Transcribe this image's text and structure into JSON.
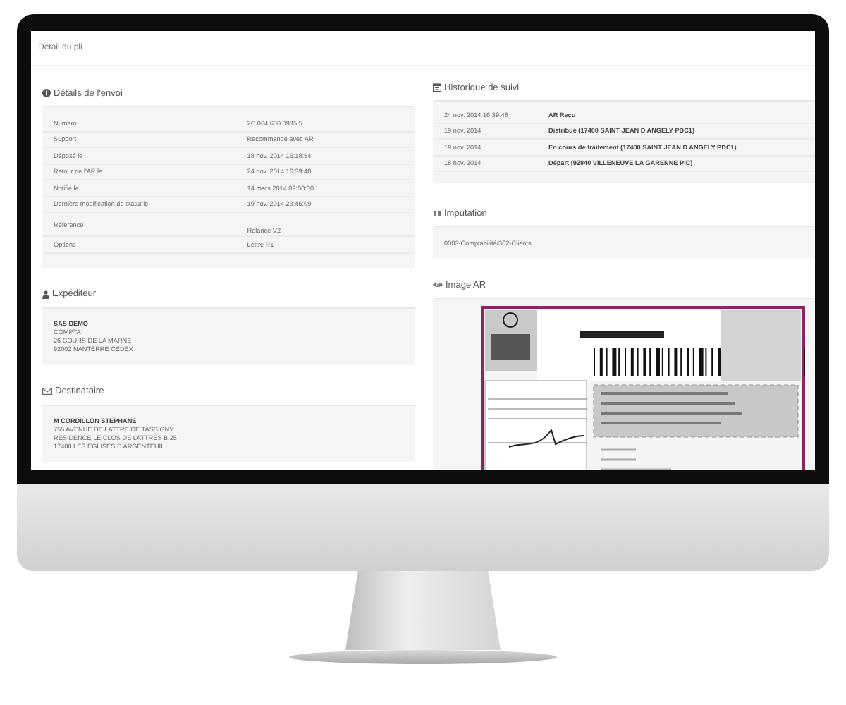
{
  "page": {
    "title": "Détail du pli"
  },
  "details": {
    "heading": "Détails de l'envoi",
    "rows": [
      {
        "label": "Numéro",
        "value": "2C 064 600 0935 5"
      },
      {
        "label": "Support",
        "value": "Recommandé avec AR"
      },
      {
        "label": "Déposé le",
        "value": "18 nov. 2014 16:18:54"
      },
      {
        "label": "Retour de l'AR le",
        "value": "24 nov. 2014 16:39:48"
      },
      {
        "label": "Notifié le",
        "value": "14 mars 2014 09:00:00"
      },
      {
        "label": "Dernière modification de statut le",
        "value": "19 nov. 2014 23:45:09"
      },
      {
        "label": "Référence",
        "value": "Relance V2"
      },
      {
        "label": "Options",
        "value": "Lettre R1"
      }
    ]
  },
  "sender": {
    "heading": "Expéditeur",
    "lines": [
      "SAS DEMO",
      "COMPTA",
      "26 COURS DE LA MARNE",
      "92002 NANTERRE CEDEX"
    ]
  },
  "recipient": {
    "heading": "Destinataire",
    "lines": [
      "M CORDILLON STEPHANE",
      "755 AVENUE DE LATTRE DE TASSIGNY",
      "RESIDENCE LE CLOS DE LATTRES B 25",
      "17400 LES EGLISES D ARGENTEUIL"
    ]
  },
  "history": {
    "heading": "Historique de suivi",
    "rows": [
      {
        "date": "24 nov. 2014 16:39:48",
        "event": "AR Reçu"
      },
      {
        "date": "19 nov. 2014",
        "event": "Distribué (17400 SAINT JEAN D ANGELY PDC1)"
      },
      {
        "date": "19 nov. 2014",
        "event": "En cours de traitement (17400 SAINT JEAN D ANGELY PDC1)"
      },
      {
        "date": "18 nov. 2014",
        "event": "Départ (92840 VILLENEUVE LA GARENNE PIC)"
      }
    ]
  },
  "imputation": {
    "heading": "Imputation",
    "value": "0003-Comptabilité/302-Clients"
  },
  "image_ar": {
    "heading": "Image AR"
  }
}
